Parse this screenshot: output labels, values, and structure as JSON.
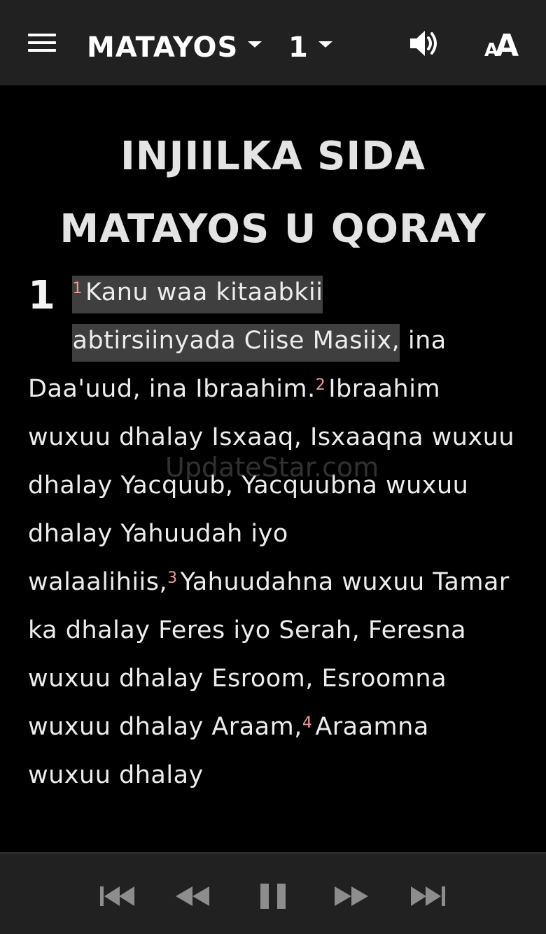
{
  "app": {
    "book": "MATAYOS",
    "chapter": "1"
  },
  "toolbar": {
    "menu_icon": "hamburger-menu-icon",
    "volume_icon": "volume-icon",
    "font_icon": "font-size-icon",
    "font_glyph_small": "A",
    "font_glyph_large": "A"
  },
  "content": {
    "heading_line1": "INJIILKA SIDA",
    "heading_line2": "MATAYOS U QORAY",
    "chapter_number": "1",
    "verses": [
      {
        "num": "1",
        "text_highlight_a": "Kanu waa kitaabkii",
        "text_highlight_b": "abtirsiinyada Ciise Masiix,",
        "text_rest": " ina Daa'uud, ina Ibraahim."
      },
      {
        "num": "2",
        "text": "Ibraahim wuxuu dhalay Isxaaq, Isxaaqna wuxuu dhalay Yacquub, Yacquubna wuxuu dhalay Yahuudah iyo walaalihiis,"
      },
      {
        "num": "3",
        "text": "Yahuudahna wuxuu Tamar ka dhalay Feres iyo Serah, Feresna wuxuu dhalay Esroom, Esroomna wuxuu dhalay Araam,"
      },
      {
        "num": "4",
        "text": "Araamna wuxuu dhalay"
      }
    ],
    "watermark": "UpdateStar.com"
  },
  "player": {
    "skip_back_icon": "skip-previous-icon",
    "rewind_icon": "rewind-icon",
    "pause_icon": "pause-icon",
    "forward_icon": "fast-forward-icon",
    "skip_next_icon": "skip-next-icon"
  },
  "colors": {
    "bar_background": "#212121",
    "page_background": "#000000",
    "text": "#ececec",
    "verse_number": "#f19a9a",
    "highlight": "#3f3f3f"
  }
}
